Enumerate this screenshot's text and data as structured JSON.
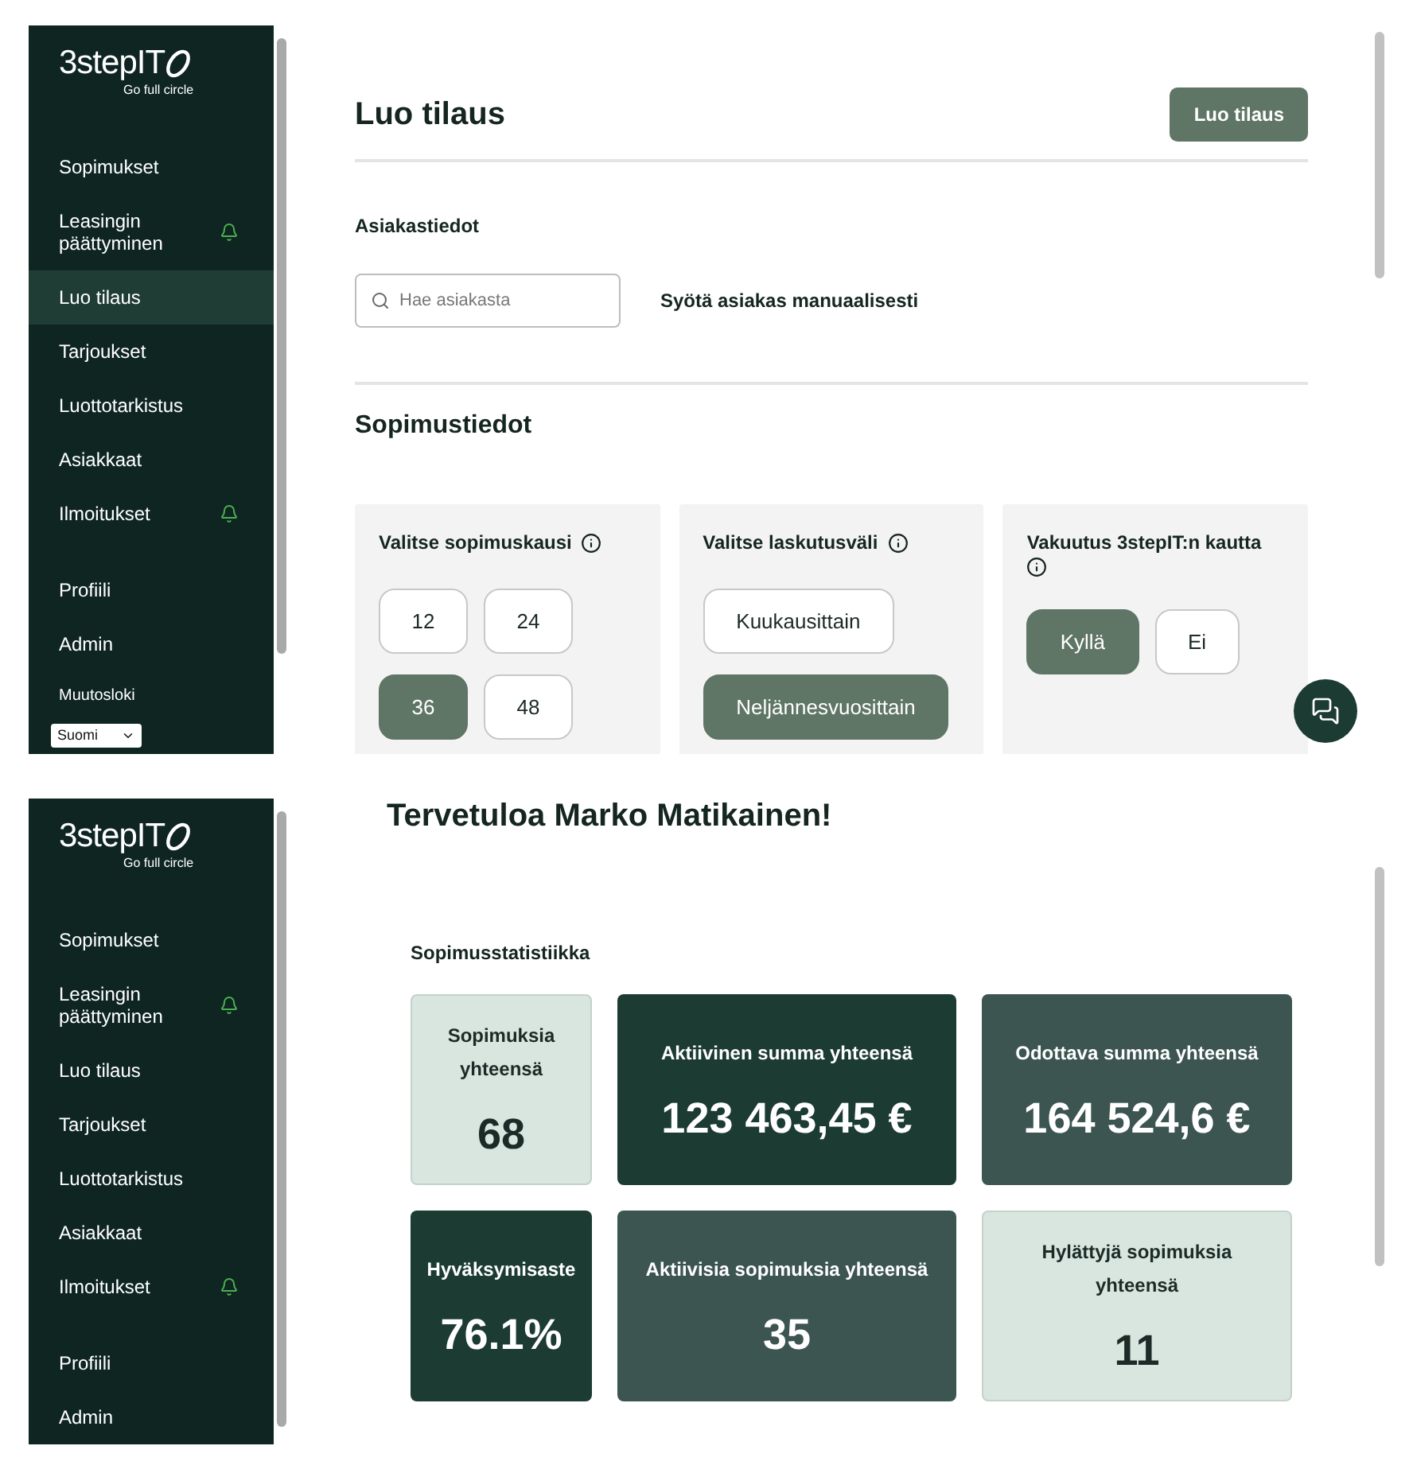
{
  "screens": [
    {
      "kind": "order",
      "sidebar": {
        "logo": {
          "wordmark": "3stepIT",
          "tagline": "Go full circle"
        },
        "main_items": [
          {
            "label": "Sopimukset",
            "selected": false,
            "notification": false
          },
          {
            "label": "Leasingin päättyminen",
            "selected": false,
            "notification": true
          },
          {
            "label": "Luo tilaus",
            "selected": true,
            "notification": false
          },
          {
            "label": "Tarjoukset",
            "selected": false,
            "notification": false
          },
          {
            "label": "Luottotarkistus",
            "selected": false,
            "notification": false
          },
          {
            "label": "Asiakkaat",
            "selected": false,
            "notification": false
          },
          {
            "label": "Ilmoitukset",
            "selected": false,
            "notification": true
          }
        ],
        "account_items": [
          {
            "label": "Profiili",
            "selected": false
          },
          {
            "label": "Admin",
            "selected": false
          }
        ],
        "changelog_link": "Muutosloki",
        "language_select": {
          "value": "Suomi"
        }
      },
      "header": {
        "title": "Luo tilaus",
        "action_button": "Luo tilaus"
      },
      "customer_section": {
        "heading": "Asiakastiedot",
        "search": {
          "placeholder": "Hae asiakasta"
        },
        "manual_link": "Syötä asiakas manuaalisesti"
      },
      "contract_section": {
        "heading": "Sopimustiedot",
        "cards": [
          {
            "title": "Valitse sopimuskausi",
            "kind": "grid",
            "options": [
              {
                "label": "12",
                "selected": false
              },
              {
                "label": "24",
                "selected": false
              },
              {
                "label": "36",
                "selected": true
              },
              {
                "label": "48",
                "selected": false
              }
            ]
          },
          {
            "title": "Valitse laskutusväli",
            "kind": "stack",
            "options": [
              {
                "label": "Kuukausittain",
                "selected": false
              },
              {
                "label": "Neljännesvuosittain",
                "selected": true
              }
            ]
          },
          {
            "title": "Vakuutus 3stepIT:n kautta",
            "kind": "row",
            "options": [
              {
                "label": "Kyllä",
                "selected": true
              },
              {
                "label": "Ei",
                "selected": false
              }
            ]
          }
        ]
      }
    },
    {
      "kind": "dashboard",
      "sidebar": {
        "logo": {
          "wordmark": "3stepIT",
          "tagline": "Go full circle"
        },
        "main_items": [
          {
            "label": "Sopimukset",
            "selected": false,
            "notification": false
          },
          {
            "label": "Leasingin päättyminen",
            "selected": false,
            "notification": true
          },
          {
            "label": "Luo tilaus",
            "selected": false,
            "notification": false
          },
          {
            "label": "Tarjoukset",
            "selected": false,
            "notification": false
          },
          {
            "label": "Luottotarkistus",
            "selected": false,
            "notification": false
          },
          {
            "label": "Asiakkaat",
            "selected": false,
            "notification": false
          },
          {
            "label": "Ilmoitukset",
            "selected": false,
            "notification": true
          }
        ],
        "account_items": [
          {
            "label": "Profiili",
            "selected": false
          },
          {
            "label": "Admin",
            "selected": false
          }
        ]
      },
      "title": "Tervetuloa Marko Matikainen!",
      "stats_section": {
        "heading": "Sopimusstatistiikka",
        "cards": [
          {
            "label": "Sopimuksia yhteensä",
            "value": "68",
            "color": "#d9e5df"
          },
          {
            "label": "Aktiivinen summa yhteensä",
            "value": "123 463,45 €",
            "color": "#1c3b33"
          },
          {
            "label": "Odottava summa yhteensä",
            "value": "164 524,6 €",
            "color": "#3c5551"
          },
          {
            "label": "Hyväksymisaste",
            "value": "76.1%",
            "color": "#1c3b33"
          },
          {
            "label": "Aktiivisia sopimuksia yhteensä",
            "value": "35",
            "color": "#3c5551"
          },
          {
            "label": "Hylättyjä sopimuksia yhteensä",
            "value": "11",
            "color": "#d9e5df"
          }
        ]
      }
    }
  ]
}
